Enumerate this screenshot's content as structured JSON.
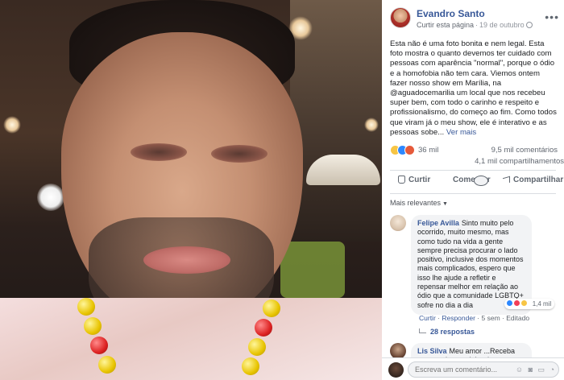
{
  "post": {
    "author": "Evandro Santo",
    "follow_label": "Curtir esta página",
    "separator": "·",
    "date": "19 de outubro",
    "options_icon": "more-options-icon",
    "text": "Esta não é uma foto bonita e nem legal. Esta foto mostra o quanto devemos ter cuidado com pessoas com aparência \"normal\", porque o ódio e a homofobia não tem cara. Viemos ontem fazer nosso show em Marília, na @aguadocemarilia um local que nos recebeu super bem, com todo o carinho e respeito e profissionalismo, do começo ao fim. Como todos que viram já o meu show, ele é interativo e as pessoas sobe...",
    "see_more": "Ver mais"
  },
  "stats": {
    "reactions": "36 mil",
    "comments": "9,5 mil comentários",
    "shares": "4,1 mil compartilhamentos"
  },
  "actions": {
    "like": "Curtir",
    "comment": "Comentar",
    "share": "Compartilhar"
  },
  "comments_filter": "Mais relevantes",
  "comments": [
    {
      "name": "Felipe Avilla",
      "text": "Sinto muito pelo ocorrido, muito mesmo, mas como tudo na vida a gente sempre precisa procurar o lado positivo, inclusive dos momentos mais complicados, espero que isso lhe ajude a refletir e repensar melhor em relação ao ódio que a comunidade LGBTQ+ sofre no dia a dia",
      "reactions": "1,4 mil",
      "like_label": "Curtir",
      "reply_label": "Responder",
      "time": "5 sem",
      "edited": "Editado",
      "replies": "28 respostas"
    },
    {
      "name": "Lis Silva",
      "text": "Meu amor ...Receba meu apoio e carinho de Guarulhos ... Bom recuperação e"
    }
  ],
  "composer": {
    "placeholder": "Escreva um comentário..."
  },
  "colors": {
    "link": "#385898",
    "like_blue": "#2d88ff",
    "angry": "#e65a3a",
    "sad": "#f7c544"
  }
}
